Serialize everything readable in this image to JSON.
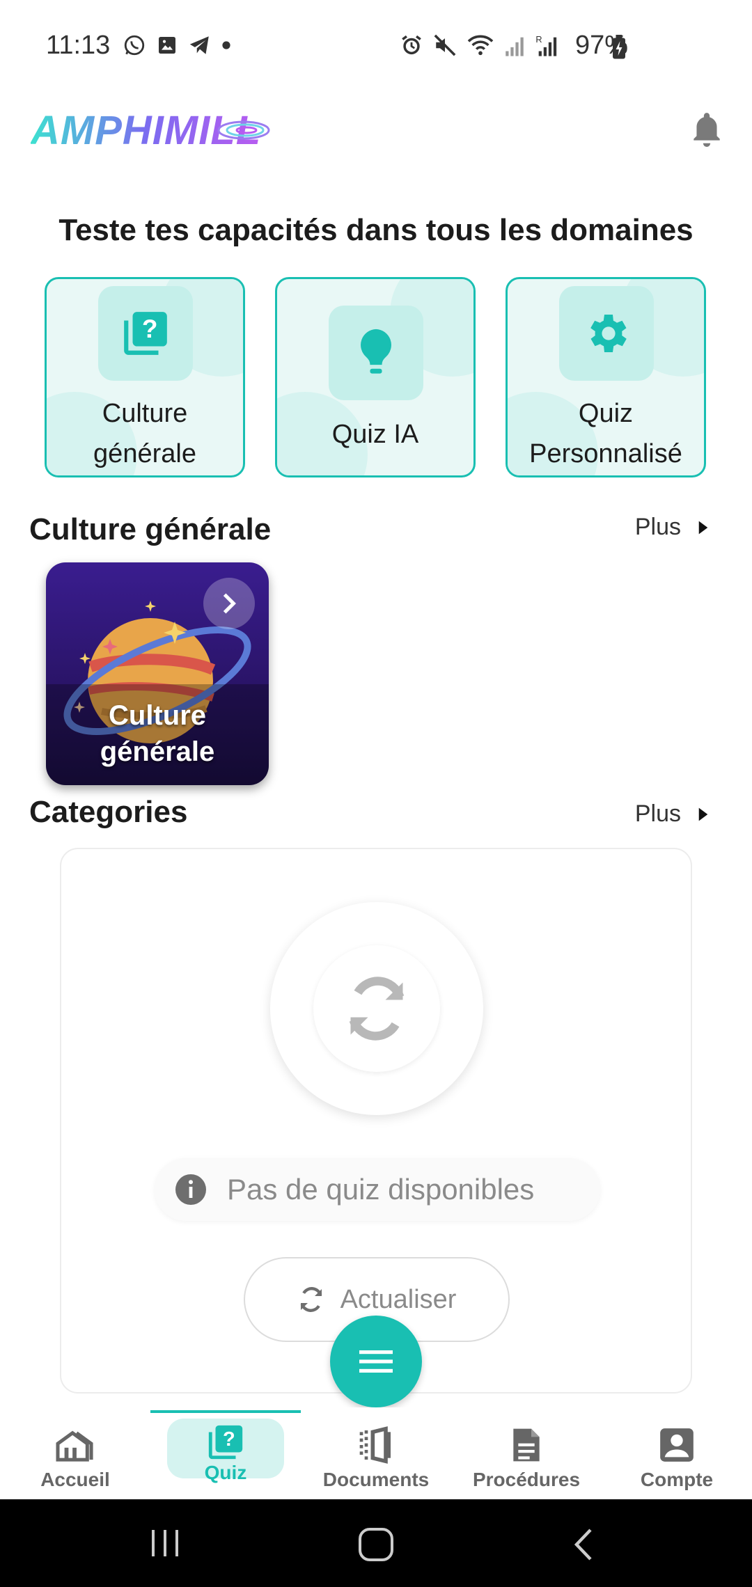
{
  "status_bar": {
    "time": "11:13",
    "battery_text": "97%",
    "left_icons": [
      "whatsapp-icon",
      "gallery-icon",
      "telegram-icon",
      "dot-icon"
    ],
    "right_icons": [
      "alarm-icon",
      "mute-icon",
      "wifi-icon",
      "signal-icon",
      "signal-roaming-icon",
      "battery-charging-icon"
    ]
  },
  "app_bar": {
    "logo_text": "AMPHIMILL",
    "notification_icon": "bell-icon"
  },
  "headline": "Teste tes capacités dans tous les domaines",
  "mode_cards": [
    {
      "label_line1": "Culture",
      "label_line2": "générale",
      "icon": "quiz-question-icon"
    },
    {
      "label_line1": "Quiz IA",
      "icon": "lightbulb-icon"
    },
    {
      "label_line1": "Quiz",
      "label_line2": "Personnalisé",
      "icon": "gear-icon"
    }
  ],
  "section_general": {
    "title": "Culture générale",
    "more_label": "Plus"
  },
  "quiz_tile": {
    "label_line1": "Culture",
    "label_line2": "générale"
  },
  "section_categories": {
    "title": "Categories",
    "more_label": "Plus"
  },
  "empty_state": {
    "message": "Pas de quiz disponibles",
    "refresh_label": "Actualiser"
  },
  "bottom_nav": {
    "items": [
      {
        "label": "Accueil",
        "icon": "home-icon"
      },
      {
        "label": "Quiz",
        "icon": "quiz-icon",
        "active": true
      },
      {
        "label": "Documents",
        "icon": "documents-icon"
      },
      {
        "label": "Procédures",
        "icon": "procedure-doc-icon"
      },
      {
        "label": "Compte",
        "icon": "account-icon"
      }
    ]
  },
  "colors": {
    "accent": "#19bfb2",
    "accent_light": "#d5f3f0",
    "text_dark": "#1c1c1c",
    "text_muted": "#8a8a8a"
  }
}
